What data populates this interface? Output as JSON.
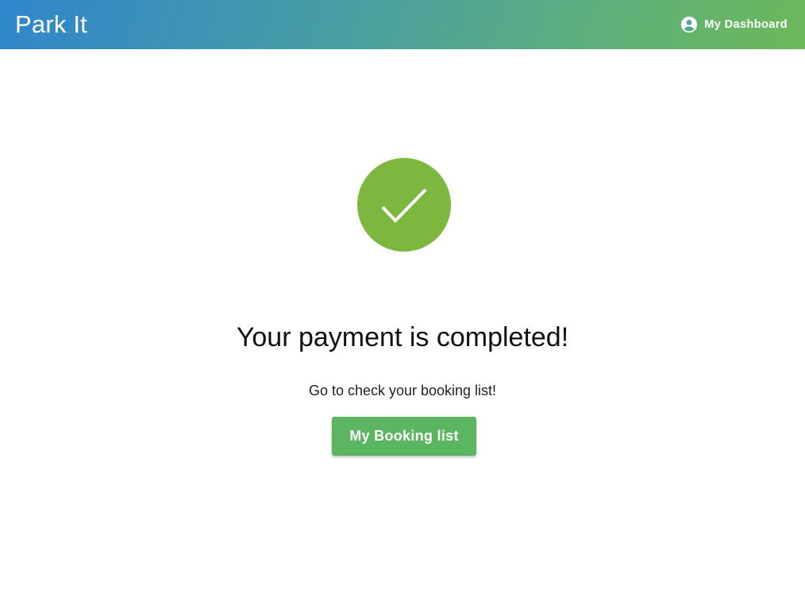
{
  "header": {
    "title": "Park It",
    "dashboard_label": "My Dashboard",
    "dashboard_icon": "account-circle-icon"
  },
  "main": {
    "status_icon": "check-circle-icon",
    "heading": "Your payment is completed!",
    "subtext": "Go to check your booking list!",
    "button_label": "My Booking list"
  },
  "colors": {
    "header_gradient_start": "#2f86cc",
    "header_gradient_end": "#6cb85a",
    "success_circle": "#7db740",
    "button": "#5cb561"
  }
}
